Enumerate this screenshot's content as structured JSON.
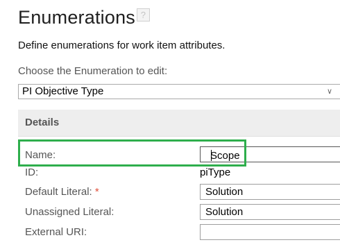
{
  "page": {
    "title": "Enumerations",
    "help_icon": "?",
    "description": "Define enumerations for work item attributes."
  },
  "chooser": {
    "label": "Choose the Enumeration to edit:",
    "selected": "PI Objective Type",
    "chevron": "∨"
  },
  "details": {
    "header": "Details",
    "name_label": "Name:",
    "name_value": "Scope",
    "id_label": "ID:",
    "id_value": "piType",
    "default_literal_label": "Default Literal: ",
    "default_literal_required": "*",
    "default_literal_value": "Solution",
    "unassigned_literal_label": "Unassigned Literal:",
    "unassigned_literal_value": "Solution",
    "external_uri_label": "External URI:",
    "external_uri_value": ""
  },
  "colors": {
    "highlight": "#2eae4c",
    "required": "#e0503c"
  }
}
